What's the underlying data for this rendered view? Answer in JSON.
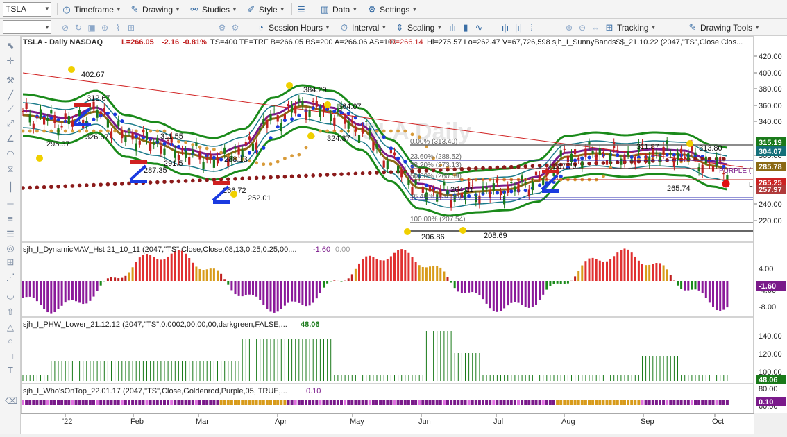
{
  "toolbar1": {
    "symbol": "TSLA",
    "items": [
      "Timeframe",
      "Drawing",
      "Studies",
      "Style",
      "Data",
      "Settings"
    ]
  },
  "toolbar2": {
    "items": [
      "Session Hours",
      "Interval",
      "Scaling",
      "Tracking",
      "Drawing Tools"
    ]
  },
  "chart": {
    "header": {
      "title": "TSLA - Daily  NASDAQ",
      "last": "L=266.05",
      "change": "-2.16",
      "pct": "-0.81%",
      "info": "TS=400  TE=TRF  B=266.05  BS=200  A=266.06  AS=100",
      "open": "O=266.14",
      "rest": "Hi=275.57  Lo=262.47  V=67,726,598  sjh_I_SunnyBands$$_21.10.22 (2047,\"TS\",Close,Clos..."
    },
    "watermark": "TSLA Daily",
    "price_labels": [
      "402.67",
      "312.67",
      "326.67",
      "295.37",
      "311.55",
      "287.35",
      "291.5",
      "288.13",
      "266.72",
      "252.01",
      "384.29",
      "364.07",
      "324.37",
      "206.86",
      "208.69",
      "264.21",
      "287.79",
      "311.87",
      "313.80",
      "265.74"
    ],
    "fib_labels": [
      "0.00% (313.40)",
      "23.60% (288.52)",
      "38.20% (273.13)",
      "50.00% (260.69)",
      "76.40% (232.86)",
      "100.00% (207.54)"
    ],
    "purple_label": "PURPLE (",
    "right_marker": "L",
    "yaxis_ticks": [
      "420.00",
      "400.00",
      "380.00",
      "360.00",
      "340.00",
      "300.00",
      "240.00",
      "220.00"
    ],
    "yaxis_tags": [
      {
        "text": "315.19",
        "color": "#1a7a1a"
      },
      {
        "text": "304.07",
        "color": "#15707a"
      },
      {
        "text": "285.78",
        "color": "#8b6914"
      },
      {
        "text": "265.25",
        "color": "#cc2222"
      },
      {
        "text": "257.97",
        "color": "#b03a3a"
      }
    ],
    "xaxis": [
      "'22",
      "Feb",
      "Mar",
      "Apr",
      "May",
      "Jun",
      "Jul",
      "Aug",
      "Sep",
      "Oct"
    ]
  },
  "indicators": {
    "i1": {
      "name": "sjh_I_DynamicMAV_Hst 21_10_11 (2047,\"TS\",Close,Close,08,13,0.25,0.25,00,...",
      "val1": "-1.60",
      "val2": "0.00",
      "ticks": [
        "4.00",
        "-4.00",
        "-8.00"
      ],
      "tag": "-1.60"
    },
    "i2": {
      "name": "sjh_I_PHW_Lower_21.12.12 (2047,\"TS\",0.0002,00,00,00,darkgreen,FALSE,...",
      "val1": "48.06",
      "ticks": [
        "140.00",
        "120.00",
        "100.00",
        "80.00",
        "60.00"
      ],
      "tag": "48.06"
    },
    "i3": {
      "name": "sjh_I_Who'sOnTop_22.01.17 (2047,\"TS\",Close,Goldenrod,Purple,05, TRUE,...",
      "val1": "0.10",
      "tag": "0.10"
    }
  },
  "colors": {
    "up": "#1a7a1a",
    "down": "#c02020",
    "purple": "#7a1a8a",
    "gold": "#d89b1a",
    "teal": "#1a7a8a",
    "blue": "#1a3ae0",
    "maroon": "#8b1a1a",
    "orange": "#d89b3a",
    "green": "#1a8a1a"
  }
}
